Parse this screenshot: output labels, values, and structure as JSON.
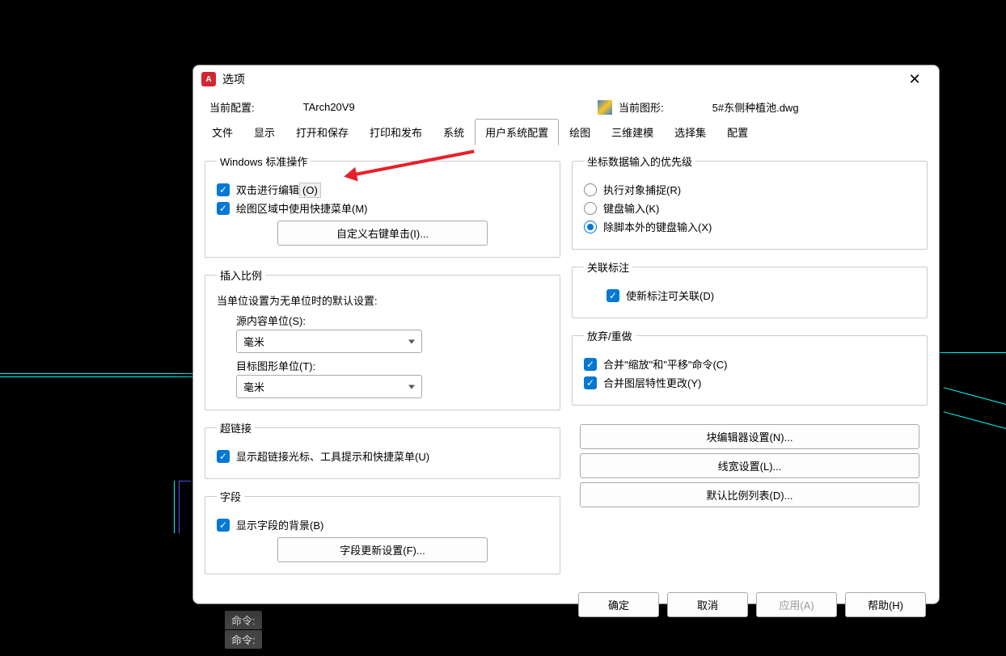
{
  "dialog": {
    "title": "选项",
    "config_label": "当前配置:",
    "config_value": "TArch20V9",
    "drawing_label": "当前图形:",
    "drawing_value": "5#东侧种植池.dwg"
  },
  "tabs": [
    "文件",
    "显示",
    "打开和保存",
    "打印和发布",
    "系统",
    "用户系统配置",
    "绘图",
    "三维建模",
    "选择集",
    "配置"
  ],
  "active_tab_index": 5,
  "left": {
    "windows_std": {
      "legend": "Windows 标准操作",
      "dbl_click": "双击进行编辑",
      "dbl_click_accel": "(O)",
      "rmb_menu": "绘图区域中使用快捷菜单(M)",
      "btn_custom_rmb": "自定义右键单击(I)..."
    },
    "insert_scale": {
      "legend": "插入比例",
      "desc": "当单位设置为无单位时的默认设置:",
      "src_units_label": "源内容单位(S):",
      "src_units_value": "毫米",
      "tgt_units_label": "目标图形单位(T):",
      "tgt_units_value": "毫米"
    },
    "hyperlink": {
      "legend": "超链接",
      "cb": "显示超链接光标、工具提示和快捷菜单(U)"
    },
    "fields": {
      "legend": "字段",
      "cb": "显示字段的背景(B)",
      "btn": "字段更新设置(F)..."
    }
  },
  "right": {
    "coord_priority": {
      "legend": "坐标数据输入的优先级",
      "r1": "执行对象捕捉(R)",
      "r2": "键盘输入(K)",
      "r3": "除脚本外的键盘输入(X)"
    },
    "assoc_dim": {
      "legend": "关联标注",
      "cb": "使新标注可关联(D)"
    },
    "undo_redo": {
      "legend": "放弃/重做",
      "cb1": "合并\"缩放\"和\"平移\"命令(C)",
      "cb2": "合并图层特性更改(Y)"
    },
    "btn_block_editor": "块编辑器设置(N)...",
    "btn_lineweight": "线宽设置(L)...",
    "btn_default_scale": "默认比例列表(D)..."
  },
  "footer": {
    "ok": "确定",
    "cancel": "取消",
    "apply": "应用(A)",
    "help": "帮助(H)"
  },
  "cmdline": {
    "prefix": "命令:"
  }
}
